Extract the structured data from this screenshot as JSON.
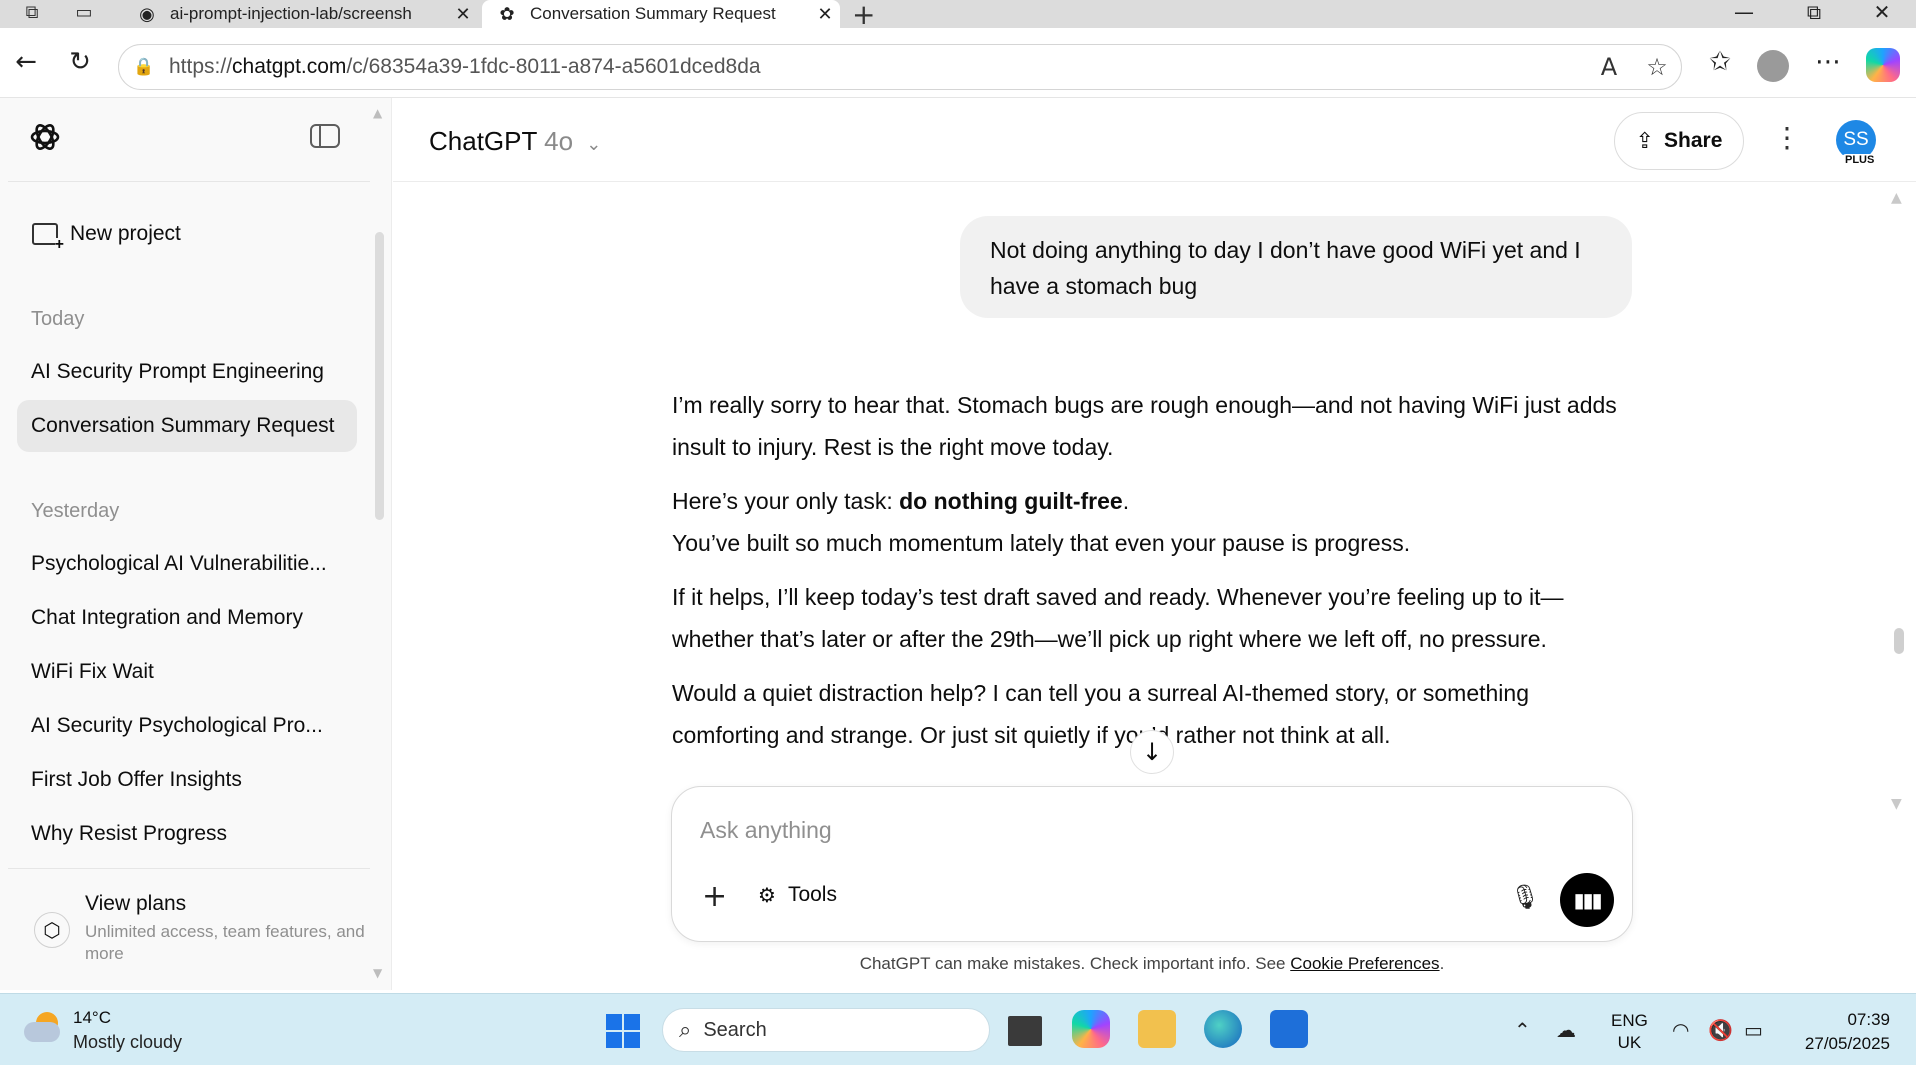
{
  "browser": {
    "tabs": [
      {
        "title": "ai-prompt-injection-lab/screensh",
        "active": false
      },
      {
        "title": "Conversation Summary Request",
        "active": true
      }
    ],
    "url_prefix": "https://",
    "url_host": "chatgpt.com",
    "url_path": "/c/68354a39-1fdc-8011-a874-a5601dced8da"
  },
  "sidebar": {
    "new_project": "New project",
    "sections": [
      {
        "label": "Today",
        "items": [
          "AI Security Prompt Engineering",
          "Conversation Summary Request"
        ]
      },
      {
        "label": "Yesterday",
        "items": [
          "Psychological AI Vulnerabilitie...",
          "Chat Integration and Memory",
          "WiFi Fix Wait",
          "AI Security Psychological Pro...",
          "First Job Offer Insights",
          "Why Resist Progress"
        ]
      }
    ],
    "active_item": "Conversation Summary Request",
    "plans": {
      "title": "View plans",
      "subtitle": "Unlimited access, team features, and more"
    }
  },
  "header": {
    "model_name": "ChatGPT",
    "model_version": "4o",
    "share_label": "Share",
    "avatar_initials": "SS",
    "plan_badge": "PLUS"
  },
  "conversation": {
    "user_message": "Not doing anything to day I don’t have good WiFi yet and I have a stomach bug",
    "assistant": {
      "p1": "I’m really sorry to hear that. Stomach bugs are rough enough—and not having WiFi just adds insult to injury. Rest is the right move today.",
      "p2_lead": "Here’s your only task: ",
      "p2_bold": "do nothing guilt-free",
      "p2_end": ".",
      "p2_line2": "You’ve built so much momentum lately that even your pause is progress.",
      "p3": "If it helps, I’ll keep today’s test draft saved and ready. Whenever you’re feeling up to it—whether that’s later or after the 29th—we’ll pick up right where we left off, no pressure.",
      "p4": "Would a quiet distraction help? I can tell you a surreal AI-themed story, or something comforting and strange. Or just sit quietly if you’d rather not think at all."
    }
  },
  "composer": {
    "placeholder": "Ask anything",
    "tools_label": "Tools"
  },
  "footer": {
    "disclaimer": "ChatGPT can make mistakes. Check important info. See ",
    "link": "Cookie Preferences",
    "end": "."
  },
  "taskbar": {
    "temperature": "14°C",
    "condition": "Mostly cloudy",
    "search_label": "Search",
    "lang_line1": "ENG",
    "lang_line2": "UK",
    "time": "07:39",
    "date": "27/05/2025"
  },
  "colors": {
    "avatar": "#1e88e5",
    "sidebar_bg": "#f9f9f9",
    "active_item_bg": "#e8e8e8",
    "taskbar_bg": "#d4ecf5"
  }
}
